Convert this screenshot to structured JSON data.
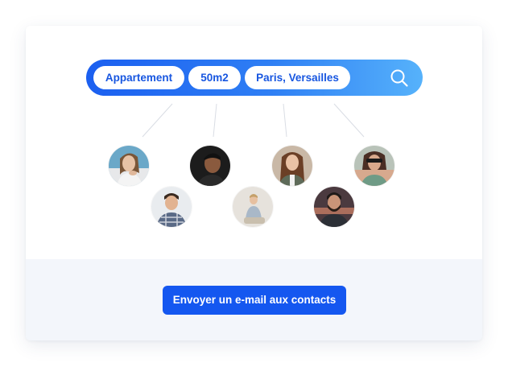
{
  "search": {
    "chips": [
      "Appartement",
      "50m2",
      "Paris, Versailles"
    ],
    "icon": "search-icon"
  },
  "contacts": {
    "avatars": [
      {
        "icon": "avatar-woman-blonde"
      },
      {
        "icon": "avatar-man-dark"
      },
      {
        "icon": "avatar-woman-brunette"
      },
      {
        "icon": "avatar-woman-sunglasses"
      },
      {
        "icon": "avatar-man-plaid-shirt"
      },
      {
        "icon": "avatar-woman-sitting"
      },
      {
        "icon": "avatar-man-beard"
      }
    ]
  },
  "cta": {
    "label": "Envoyer un e-mail aux contacts"
  },
  "colors": {
    "accent": "#1457f0",
    "gradient_start": "#1b5ff0",
    "gradient_end": "#56b2fb",
    "bottom_panel": "#f3f6fb"
  }
}
